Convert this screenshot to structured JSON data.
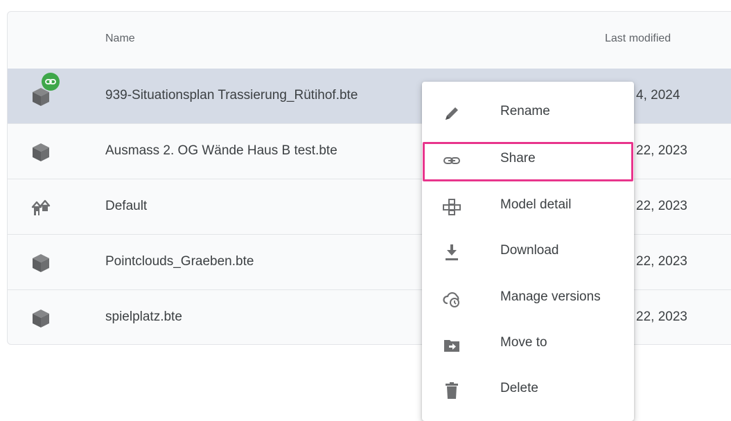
{
  "table": {
    "headers": {
      "name": "Name",
      "last_modified": "Last modified"
    },
    "rows": [
      {
        "name": "939-Situationsplan Trassierung_Rütihof.bte",
        "date": "4, 2024",
        "icon": "model-cube-icon",
        "shared": true,
        "selected": true
      },
      {
        "name": "Ausmass 2. OG Wände Haus B test.bte",
        "date": "22, 2023",
        "icon": "model-cube-icon"
      },
      {
        "name": "Default",
        "date": "22, 2023",
        "icon": "houses-icon"
      },
      {
        "name": "Pointclouds_Graeben.bte",
        "date": "22, 2023",
        "icon": "model-cube-icon"
      },
      {
        "name": "spielplatz.bte",
        "date": "22, 2023",
        "icon": "model-cube-icon"
      }
    ]
  },
  "context_menu": {
    "items": [
      {
        "label": "Rename",
        "icon": "pencil-icon"
      },
      {
        "label": "Share",
        "icon": "link-icon",
        "highlighted": true
      },
      {
        "label": "Model detail",
        "icon": "model-tree-icon"
      },
      {
        "label": "Download",
        "icon": "download-icon"
      },
      {
        "label": "Manage versions",
        "icon": "cloud-clock-icon"
      },
      {
        "label": "Move to",
        "icon": "folder-move-icon"
      },
      {
        "label": "Delete",
        "icon": "trash-icon"
      }
    ]
  },
  "colors": {
    "selected_row": "#d5dbe6",
    "highlight_border": "#e8358c",
    "share_badge": "#3fa74a",
    "icon_gray": "#6d6e70"
  }
}
